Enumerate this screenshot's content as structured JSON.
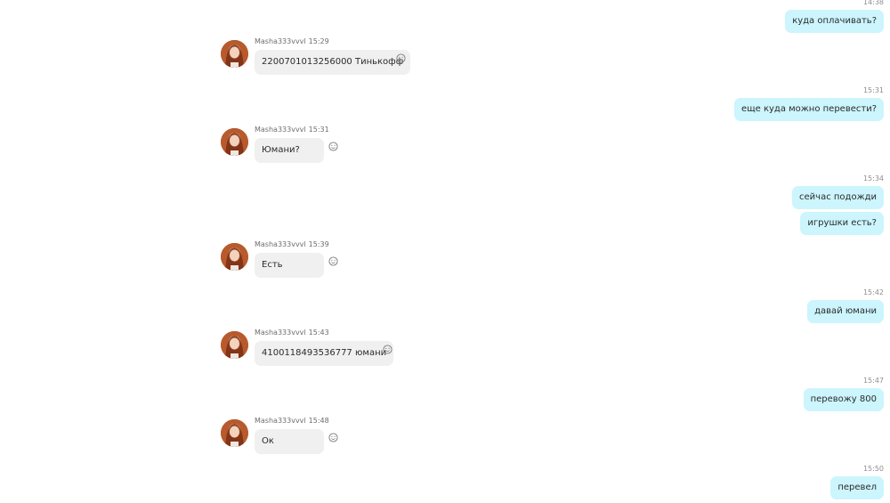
{
  "messages": [
    {
      "id": "m1",
      "direction": "out",
      "time": "14:38",
      "text": "куда оплачивать?"
    },
    {
      "id": "m2",
      "direction": "in",
      "sender": "Masha333vvvl",
      "time": "15:29",
      "text": "2200701013256000 Тинькофф"
    },
    {
      "id": "m3",
      "direction": "out",
      "time": "15:31",
      "text": "еще куда можно перевести?"
    },
    {
      "id": "m4",
      "direction": "in",
      "sender": "Masha333vvvl",
      "time": "15:31",
      "text": "Юмани?"
    },
    {
      "id": "m5",
      "direction": "out",
      "time": "15:34",
      "text": "сейчас подожди"
    },
    {
      "id": "m6",
      "direction": "out",
      "time": "",
      "text": "игрушки есть?"
    },
    {
      "id": "m7",
      "direction": "in",
      "sender": "Masha333vvvl",
      "time": "15:39",
      "text": "Есть"
    },
    {
      "id": "m8",
      "direction": "out",
      "time": "15:42",
      "text": "давай юмани"
    },
    {
      "id": "m9",
      "direction": "in",
      "sender": "Masha333vvvl",
      "time": "15:43",
      "text": "4100118493536777 юмани"
    },
    {
      "id": "m10",
      "direction": "out",
      "time": "15:47",
      "text": "перевожу 800"
    },
    {
      "id": "m11",
      "direction": "in",
      "sender": "Masha333vvvl",
      "time": "15:48",
      "text": "Ок"
    },
    {
      "id": "m12",
      "direction": "out",
      "time": "15:50",
      "text": "перевел"
    }
  ],
  "icons": {
    "reaction": "smiley-icon",
    "avatar": "avatar"
  },
  "colors": {
    "outgoing_bubble": "#ccf5fd",
    "incoming_bubble": "#f0f0f0",
    "background": "#ffffff",
    "meta_text": "#8e8e8e"
  }
}
